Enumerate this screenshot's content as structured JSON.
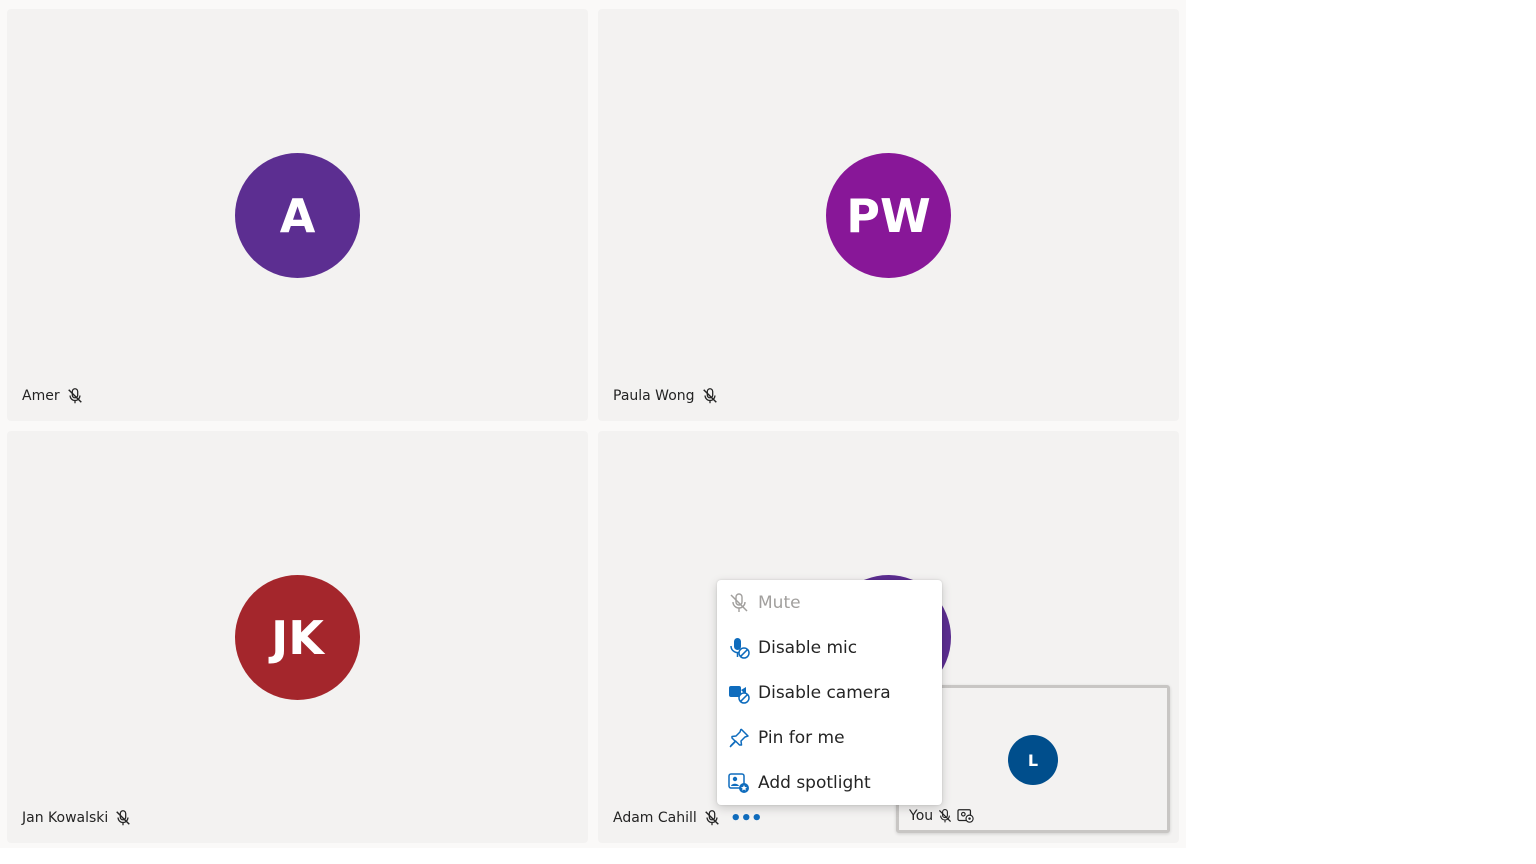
{
  "participants": [
    {
      "name": "Amer",
      "initials": "A",
      "color": "#5c2e91"
    },
    {
      "name": "Paula Wong",
      "initials": "PW",
      "color": "#881798"
    },
    {
      "name": "Jan Kowalski",
      "initials": "JK",
      "color": "#a4262c"
    },
    {
      "name": "Adam Cahill",
      "initials": "",
      "color": "#5c2e91"
    }
  ],
  "more_button": "•••",
  "self_view": {
    "label": "You",
    "initials": "L",
    "color": "#004e8c"
  },
  "context_menu": {
    "items": [
      {
        "label": "Mute",
        "icon": "mic-off-icon",
        "disabled": true
      },
      {
        "label": "Disable mic",
        "icon": "mic-blocked-icon"
      },
      {
        "label": "Disable camera",
        "icon": "camera-blocked-icon"
      },
      {
        "label": "Pin for me",
        "icon": "pin-icon"
      },
      {
        "label": "Add spotlight",
        "icon": "spotlight-icon"
      }
    ]
  },
  "colors": {
    "accent": "#0f6cbd",
    "tile_bg": "#f3f2f1"
  }
}
